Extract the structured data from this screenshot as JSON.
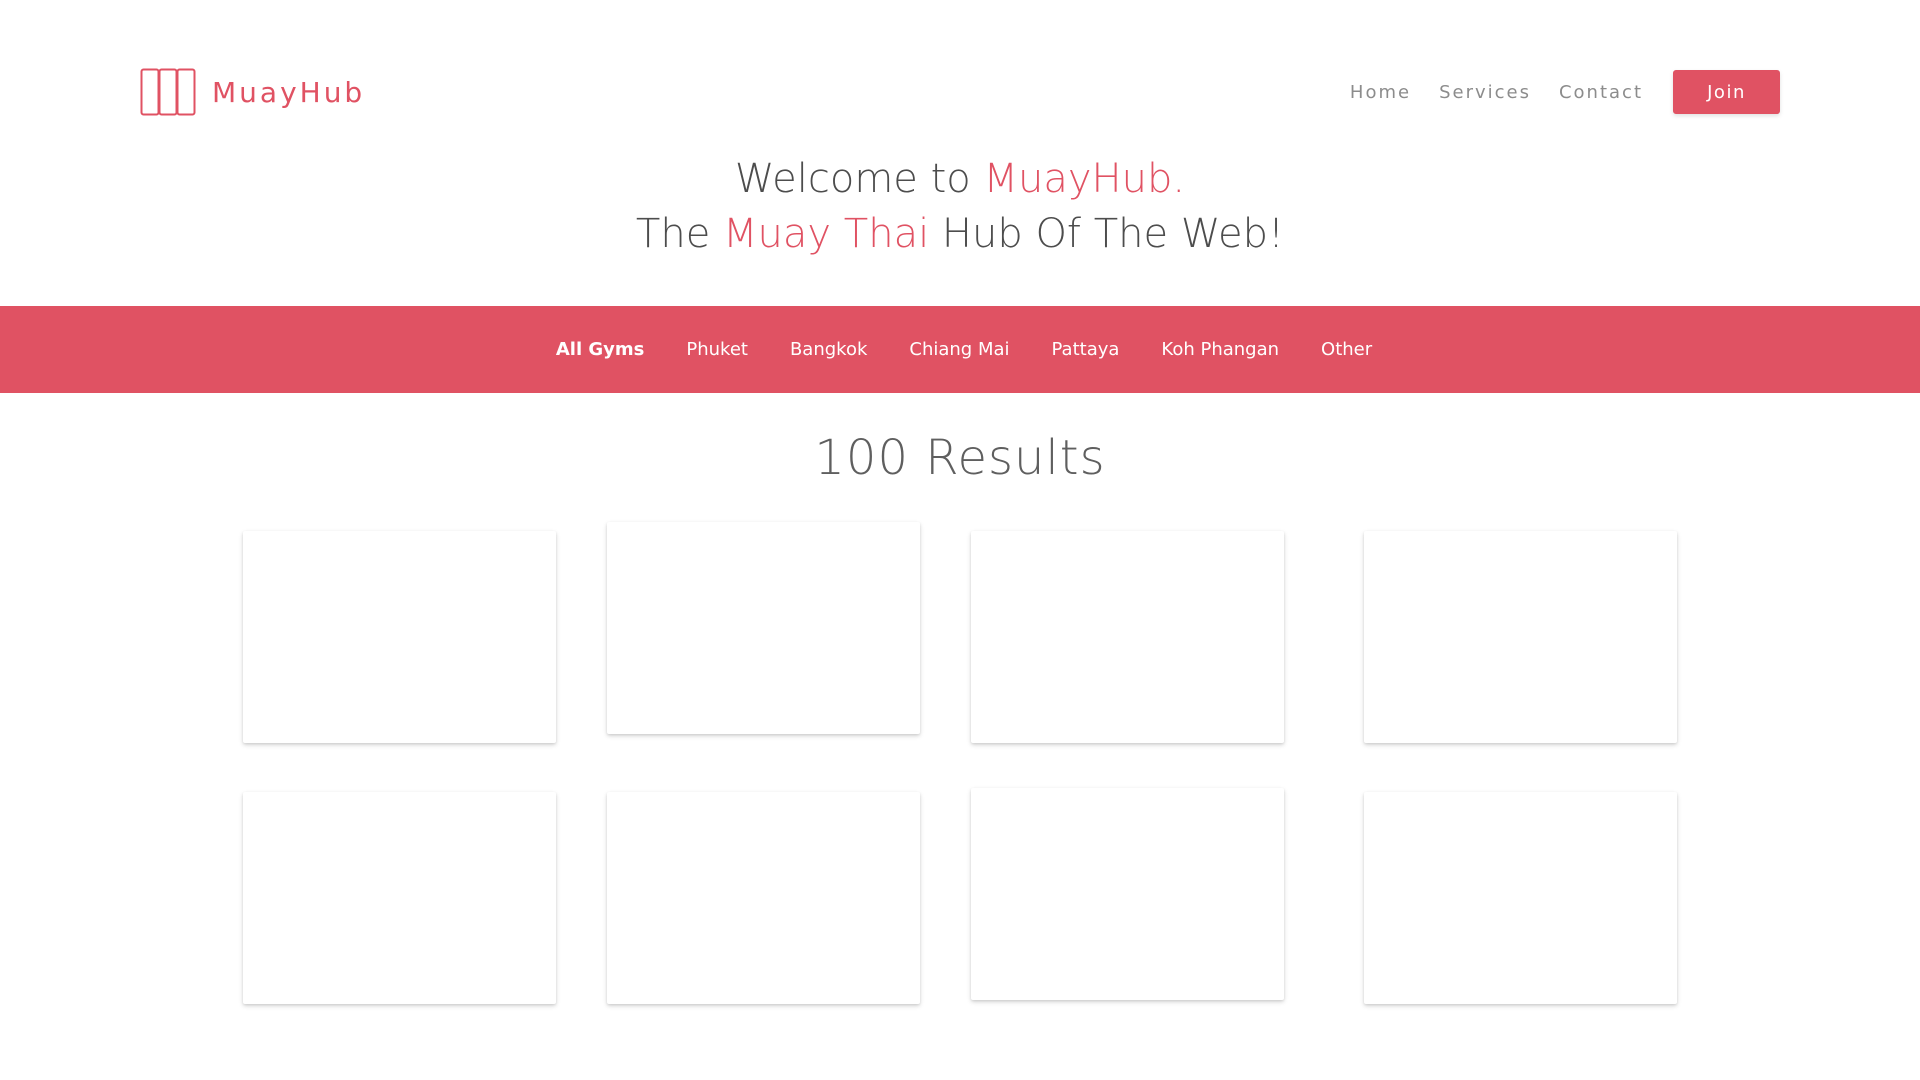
{
  "brand": {
    "name": "MuayHub",
    "color": "#e05263"
  },
  "nav": {
    "links": [
      "Home",
      "Services",
      "Contact"
    ],
    "join_label": "Join"
  },
  "hero": {
    "line1_prefix": "Welcome to ",
    "line1_accent": "MuayHub.",
    "line2_prefix": "The ",
    "line2_accent": "Muay Thai",
    "line2_suffix": " Hub Of The Web!"
  },
  "locations": {
    "active": "All Gyms",
    "tabs": [
      "All Gyms",
      "Phuket",
      "Bangkok",
      "Chiang Mai",
      "Pattaya",
      "Koh Phangan",
      "Other"
    ]
  },
  "results": {
    "title": "100 Results",
    "cards_shown": 8
  },
  "icons": {
    "logo": "three-column-rectangles-icon"
  }
}
